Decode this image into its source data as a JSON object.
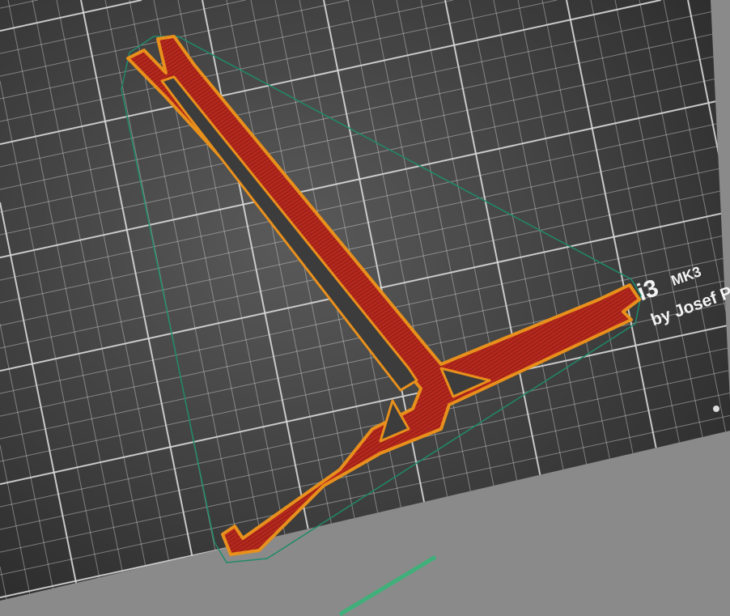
{
  "bed": {
    "label_model": "i3",
    "label_variant": "MK3",
    "label_maker": "by Josef P",
    "bed_color": "#3c3c3c",
    "grid_color": "#d8d8d8",
    "skirt_color": "#1f8a6a",
    "infill_color": "#b5281e",
    "perimeter_color": "#e8901c"
  }
}
